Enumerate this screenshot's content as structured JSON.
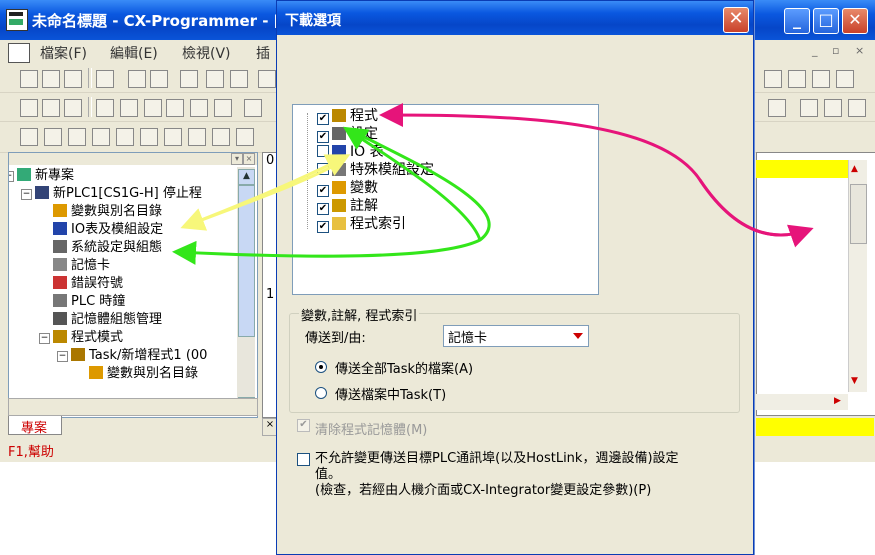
{
  "main_window": {
    "title": "未命名標題 - CX-Programmer - [新",
    "menus": [
      "檔案(F)",
      "編輯(E)",
      "檢視(V)",
      "插"
    ],
    "project_tree": [
      {
        "label": "新專案",
        "level": 0,
        "icon": "network-icon"
      },
      {
        "label": "新PLC1[CS1G-H] 停止程",
        "level": 1,
        "icon": "plc-icon"
      },
      {
        "label": "變數與別名目錄",
        "level": 2,
        "icon": "symbols-icon"
      },
      {
        "label": "IO表及模組設定",
        "level": 2,
        "icon": "io-table-icon"
      },
      {
        "label": "系統設定與組態",
        "level": 2,
        "icon": "settings-icon"
      },
      {
        "label": "記憶卡",
        "level": 2,
        "icon": "memory-card-icon"
      },
      {
        "label": "錯誤符號",
        "level": 2,
        "icon": "error-log-icon"
      },
      {
        "label": "PLC 時鐘",
        "level": 2,
        "icon": "clock-icon"
      },
      {
        "label": "記憶體組態管理",
        "level": 2,
        "icon": "memory-icon"
      },
      {
        "label": "程式模式",
        "level": 2,
        "icon": "programs-icon"
      },
      {
        "label": "Task/新增程式1 (00",
        "level": 3,
        "icon": "task-icon"
      },
      {
        "label": "變數與別名目錄",
        "level": 4,
        "icon": "symbols-icon"
      }
    ],
    "project_tab_label": "專案",
    "status_help": "F1,幫助",
    "ladder_rung_labels": [
      "0",
      "1"
    ]
  },
  "dialog": {
    "title": "下載選項",
    "close_glyph": "✕",
    "tree_items": [
      {
        "label": "程式",
        "checked": true,
        "icon": "program-icon"
      },
      {
        "label": "設定",
        "checked": true,
        "icon": "settings-icon"
      },
      {
        "label": "IO 表",
        "checked": false,
        "icon": "io-table-icon"
      },
      {
        "label": "特殊模組設定",
        "checked": false,
        "icon": "special-unit-icon"
      },
      {
        "label": "變數",
        "checked": true,
        "icon": "symbols-icon"
      },
      {
        "label": "註解",
        "checked": true,
        "icon": "comments-icon"
      },
      {
        "label": "程式索引",
        "checked": true,
        "icon": "folder-icon"
      }
    ],
    "group_title": "變數,註解, 程式索引",
    "transfer_label": "傳送到/由:",
    "transfer_value": "記憶卡",
    "radio_all": "傳送全部Task的檔案(A)",
    "radio_task": "傳送檔案中Task(T)",
    "radio_selected": "all",
    "clear_memory_label": "清除程式記憶體(M)",
    "no_change_label_line1": "不允許變更傳送目標PLC通訊埠(以及HostLink，週邊設備)設定",
    "no_change_label_line2": "值。",
    "no_change_label_line3": "(檢查，若經由人機介面或CX-Integrator變更設定參數)(P)"
  },
  "annotation_colors": {
    "pink": "#e6147a",
    "green": "#33e61a",
    "yellow": "#f7f77a"
  }
}
